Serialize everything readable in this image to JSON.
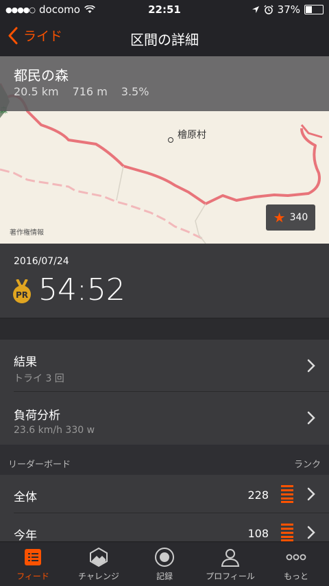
{
  "status": {
    "carrier": "docomo",
    "time": "22:51",
    "battery": "37%",
    "battery_level": 0.37
  },
  "nav": {
    "back_label": "ライド",
    "title": "区間の詳細"
  },
  "segment": {
    "name": "都民の森",
    "distance": "20.5 km",
    "elevation": "716 m",
    "grade": "3.5%"
  },
  "map": {
    "place_label": "檜原村",
    "copyright": "著作権情報",
    "star_count": "340",
    "edge_label": "森"
  },
  "effort": {
    "date": "2016/07/24",
    "pr_badge": "PR",
    "elapsed_time": "54:52"
  },
  "rows": {
    "results": {
      "title": "結果",
      "subtitle": "トライ 3 回"
    },
    "analysis": {
      "title": "負荷分析",
      "subtitle": "23.6 km/h 330 w"
    }
  },
  "leaderboard": {
    "header": "リーダーボード",
    "rank_label": "ランク",
    "entries": [
      {
        "label": "全体",
        "rank": "228"
      },
      {
        "label": "今年",
        "rank": "108"
      }
    ]
  },
  "tabs": [
    {
      "label": "フィード"
    },
    {
      "label": "チャレンジ"
    },
    {
      "label": "記録"
    },
    {
      "label": "プロフィール"
    },
    {
      "label": "もっと"
    }
  ],
  "colors": {
    "accent": "#fc5200",
    "route": "#e8747a",
    "background": "#2f2f33"
  }
}
